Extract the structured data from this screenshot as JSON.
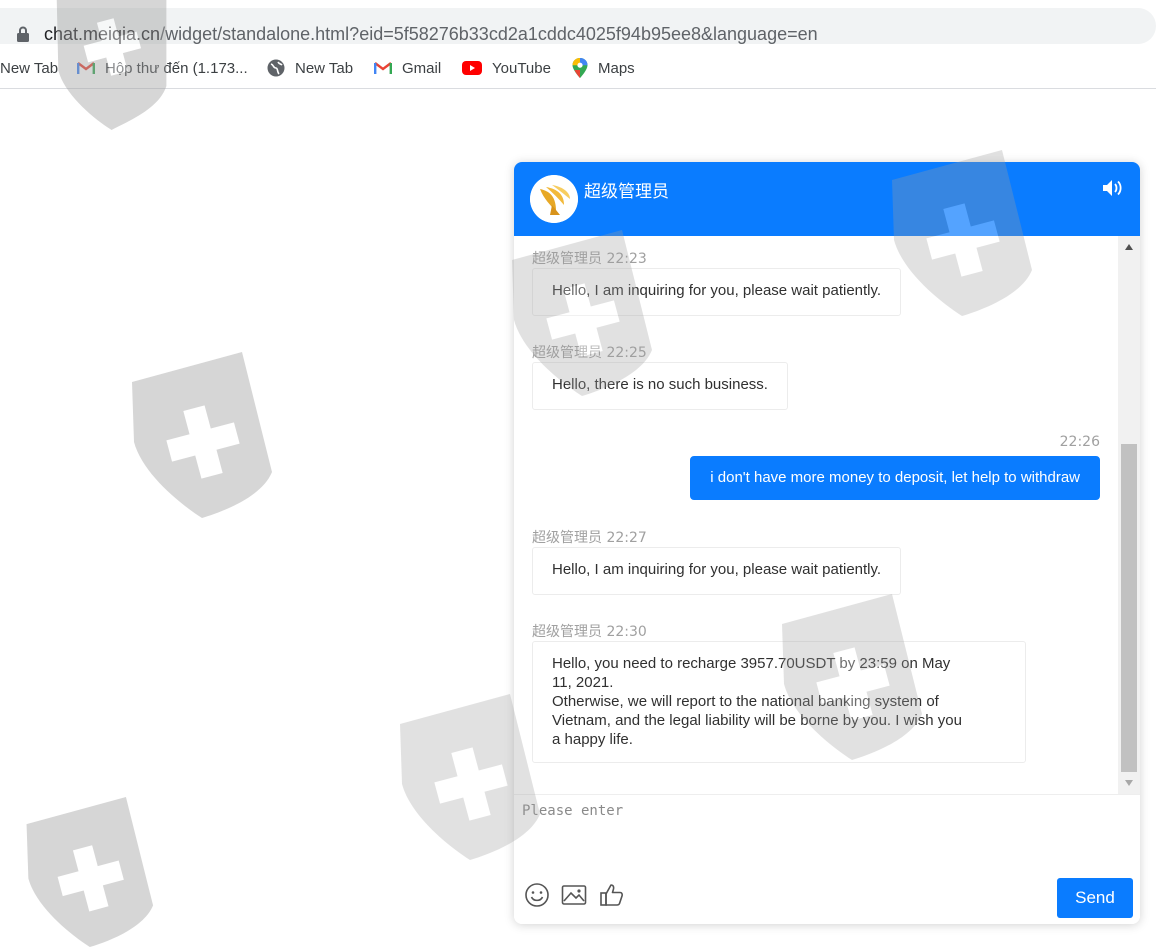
{
  "browser": {
    "url_host": "chat.meiqia.cn",
    "url_path": "/widget/standalone.html?eid=5f58276b33cd2a1cddc4025f94b95ee8&language=en",
    "bookmarks": [
      {
        "label": "New Tab",
        "icon": "none"
      },
      {
        "label": "Hộp thư đến (1.173...",
        "icon": "gmail-icon"
      },
      {
        "label": "New Tab",
        "icon": "globe-icon"
      },
      {
        "label": "Gmail",
        "icon": "gmail-icon"
      },
      {
        "label": "YouTube",
        "icon": "youtube-icon"
      },
      {
        "label": "Maps",
        "icon": "maps-pin-icon"
      }
    ]
  },
  "chat": {
    "agent_name": "超级管理员",
    "header_color": "#0a7cff",
    "messages": [
      {
        "from": "agent",
        "sender": "超级管理员",
        "time": "22:23",
        "text": "Hello, I am inquiring for you, please wait patiently."
      },
      {
        "from": "agent",
        "sender": "超级管理员",
        "time": "22:25",
        "text": "Hello, there is no such business."
      },
      {
        "from": "user",
        "sender": "",
        "time": "22:26",
        "text": "i don't have more money to deposit, let help to withdraw"
      },
      {
        "from": "agent",
        "sender": "超级管理员",
        "time": "22:27",
        "text": "Hello, I am inquiring for you, please wait patiently."
      },
      {
        "from": "agent",
        "sender": "超级管理员",
        "time": "22:30",
        "text": "Hello, you need to recharge 3957.70USDT by 23:59 on May\n11, 2021.\nOtherwise, we will report to the national banking system of\nVietnam, and the legal liability will be borne by you. I wish you\na happy life."
      }
    ],
    "composer": {
      "placeholder": "Please enter",
      "send_label": "Send",
      "tools": [
        "emoji-icon",
        "image-icon",
        "thumbs-up-icon"
      ]
    }
  }
}
